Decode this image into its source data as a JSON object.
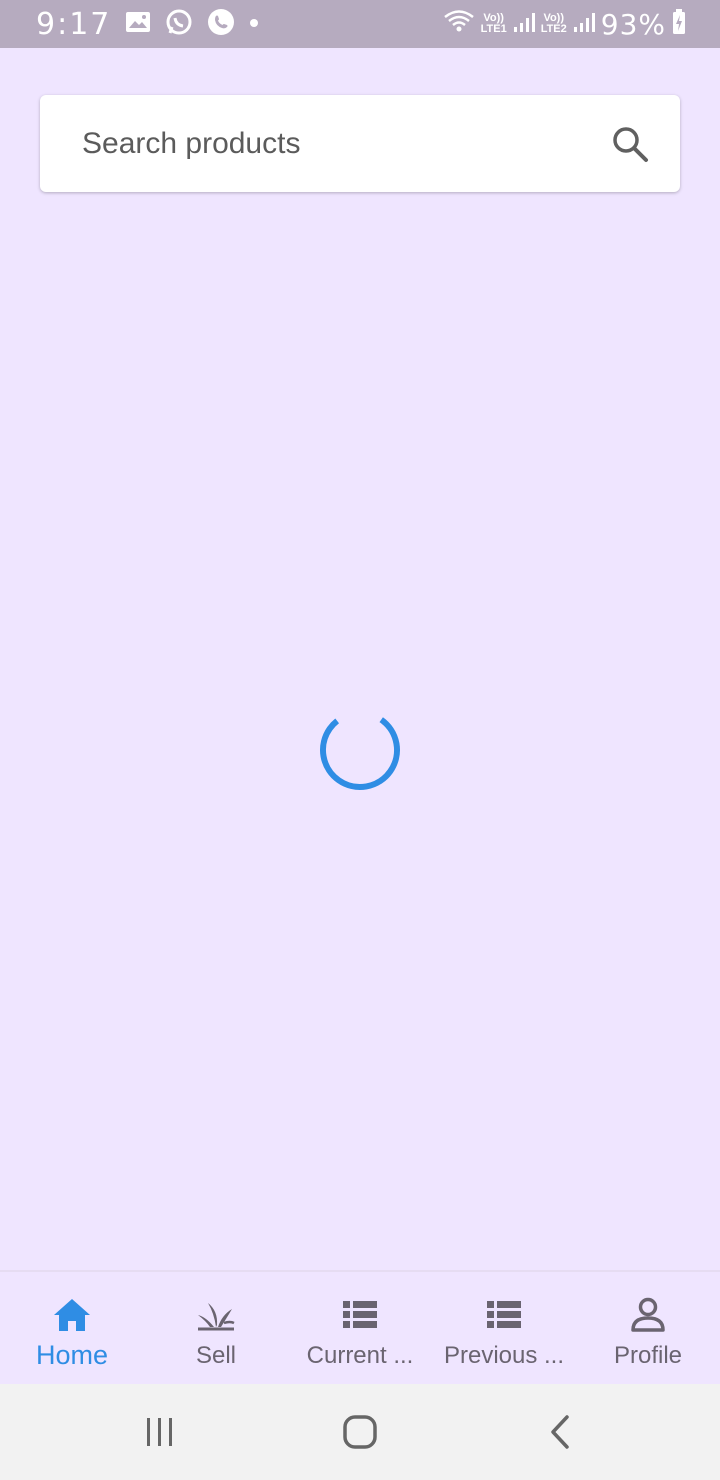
{
  "status_bar": {
    "time": "9:17",
    "network1": {
      "top": "Vo))",
      "bottom": "LTE1"
    },
    "network2": {
      "top": "Vo))",
      "bottom": "LTE2"
    },
    "battery": "93%"
  },
  "search": {
    "placeholder": "Search products",
    "value": ""
  },
  "loading": {
    "accent_color": "#2F8DE4"
  },
  "bottom_nav": {
    "active_index": 0,
    "items": [
      {
        "label": "Home",
        "icon": "home-icon"
      },
      {
        "label": "Sell",
        "icon": "plant-icon"
      },
      {
        "label": "Current ...",
        "icon": "list-icon"
      },
      {
        "label": "Previous ...",
        "icon": "list-icon"
      },
      {
        "label": "Profile",
        "icon": "person-icon"
      }
    ]
  },
  "system_nav": {
    "buttons": [
      "recent-apps-icon",
      "home-circle-icon",
      "back-icon"
    ]
  },
  "colors": {
    "background": "#EFE5FF",
    "status_bar": "#B6ABBF",
    "accent": "#2F8DE4",
    "inactive": "#6a6470"
  }
}
